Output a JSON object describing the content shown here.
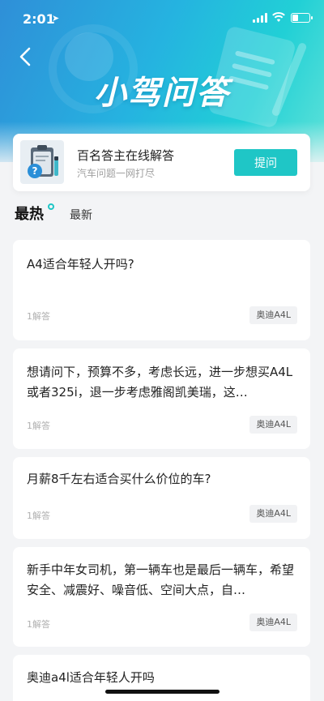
{
  "status_bar": {
    "time": "2:01",
    "battery_level": 0.3
  },
  "header": {
    "title": "小驾问答",
    "back_icon": "chevron-left-icon"
  },
  "promo": {
    "title": "百名答主在线解答",
    "subtitle": "汽车问题一网打尽",
    "ask_label": "提问",
    "icon": "clipboard-question-icon"
  },
  "tabs": {
    "hot": "最热",
    "new": "最新"
  },
  "questions": [
    {
      "text": "A4适合年轻人开吗?",
      "answers": "1解答",
      "tag": "奥迪A4L"
    },
    {
      "text": "想请问下，预算不多，考虑长远，进一步想买A4L或者325i，退一步考虑雅阁凯美瑞，这…",
      "answers": "1解答",
      "tag": "奥迪A4L"
    },
    {
      "text": "月薪8千左右适合买什么价位的车?",
      "answers": "1解答",
      "tag": "奥迪A4L"
    },
    {
      "text": "新手中年女司机，第一辆车也是最后一辆车，希望安全、减震好、噪音低、空间大点，自…",
      "answers": "1解答",
      "tag": "奥迪A4L"
    },
    {
      "text": "奥迪a4l适合年轻人开吗",
      "answers": "",
      "tag": ""
    }
  ],
  "colors": {
    "accent": "#1fc6c6",
    "header_start": "#2f8fd8",
    "header_end": "#21d0d6"
  }
}
